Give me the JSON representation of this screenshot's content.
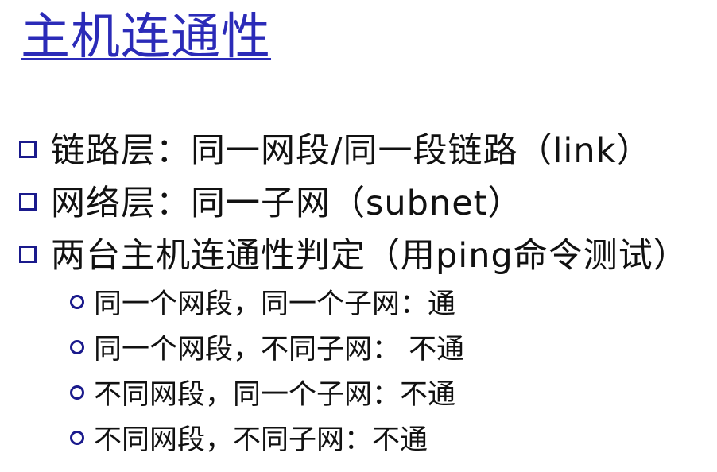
{
  "slide": {
    "title": "主机连通性",
    "bullets": [
      "链路层：同一网段/同一段链路（link）",
      "网络层：同一子网（subnet）",
      "两台主机连通性判定（用ping命令测试）"
    ],
    "sub_bullets": [
      "同一个网段，同一个子网：通",
      "同一个网段，不同子网： 不通",
      "不同网段，同一个子网：不通",
      "不同网段，不同子网：不通"
    ],
    "colors": {
      "title": "#2b2bb8",
      "bullet_marker": "#1a1a8c",
      "text": "#111111"
    },
    "icons": {
      "bullet": "hollow-square",
      "sub_bullet": "hollow-circle"
    }
  }
}
